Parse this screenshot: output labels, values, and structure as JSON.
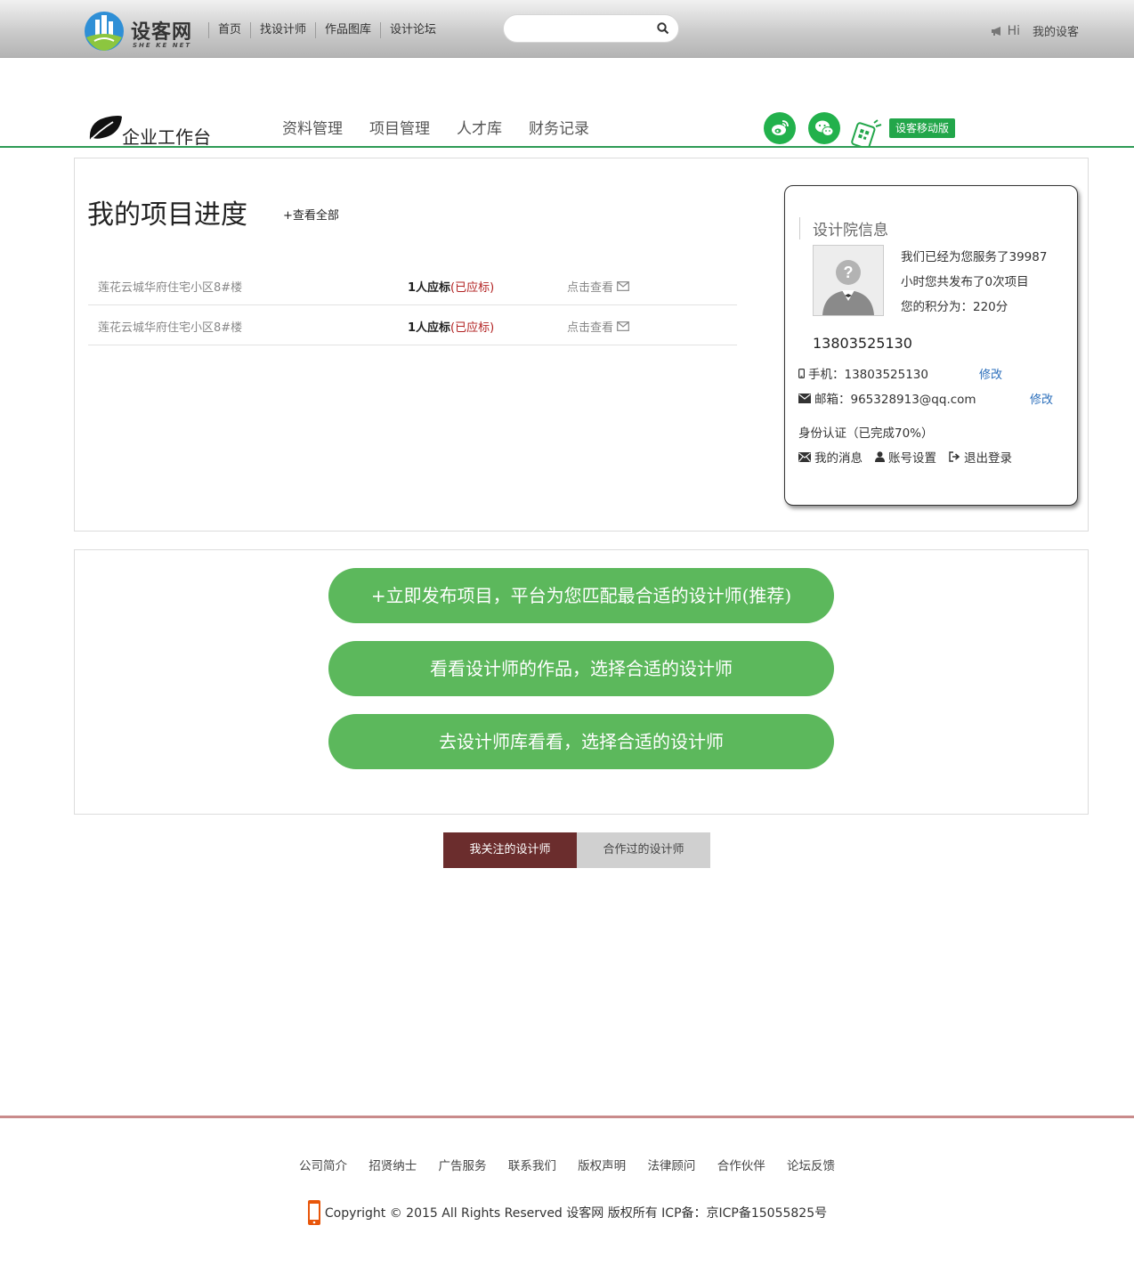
{
  "header": {
    "logo_text": "设客网",
    "logo_sub": "SHE KE NET",
    "nav": [
      "首页",
      "找设计师",
      "作品图库",
      "设计论坛"
    ],
    "search_placeholder": "",
    "hi": "Hi",
    "my_link": "我的设客"
  },
  "workspace": {
    "title": "企业工作台",
    "nav": [
      "资料管理",
      "项目管理",
      "人才库",
      "财务记录"
    ],
    "mobile_label": "设客移动版"
  },
  "progress": {
    "title": "我的项目进度",
    "view_all": "+查看全部",
    "rows": [
      {
        "name": "莲花云城华府住宅小区8#楼",
        "count": "1人应标",
        "status": "(已应标)",
        "link": "点击查看"
      },
      {
        "name": "莲花云城华府住宅小区8#楼",
        "count": "1人应标",
        "status": "(已应标)",
        "link": "点击查看"
      }
    ]
  },
  "info": {
    "title": "设计院信息",
    "serve_lines": [
      "我们已经为您服务了39987",
      "小时您共发布了0次项目",
      "您的积分为：220分"
    ],
    "phone_big": "13803525130",
    "phone_line": "手机：13803525130",
    "email_line": "邮箱：965328913@qq.com",
    "modify": "修改",
    "id_auth": "身份认证（已完成70%）",
    "actions": [
      "我的消息",
      "账号设置",
      "退出登录"
    ]
  },
  "cta": [
    "+立即发布项目，平台为您匹配最合适的设计师(推荐)",
    "看看设计师的作品，选择合适的设计师",
    "去设计师库看看，选择合适的设计师"
  ],
  "tabs": [
    "我关注的设计师",
    "合作过的设计师"
  ],
  "footer": {
    "links": [
      "公司简介",
      "招贤纳士",
      "广告服务",
      "联系我们",
      "版权声明",
      "法律顾问",
      "合作伙伴",
      "论坛反馈"
    ],
    "copyright": "Copyright © 2015 All Rights Reserved 设客网 版权所有 ICP备：京ICP备15055825号"
  },
  "colors": {
    "accent_green": "#22b14c",
    "cta_green": "#5cb85c",
    "tab_active": "#6b2d2d",
    "status_red": "#b22222",
    "link_blue": "#2a6ebb"
  }
}
